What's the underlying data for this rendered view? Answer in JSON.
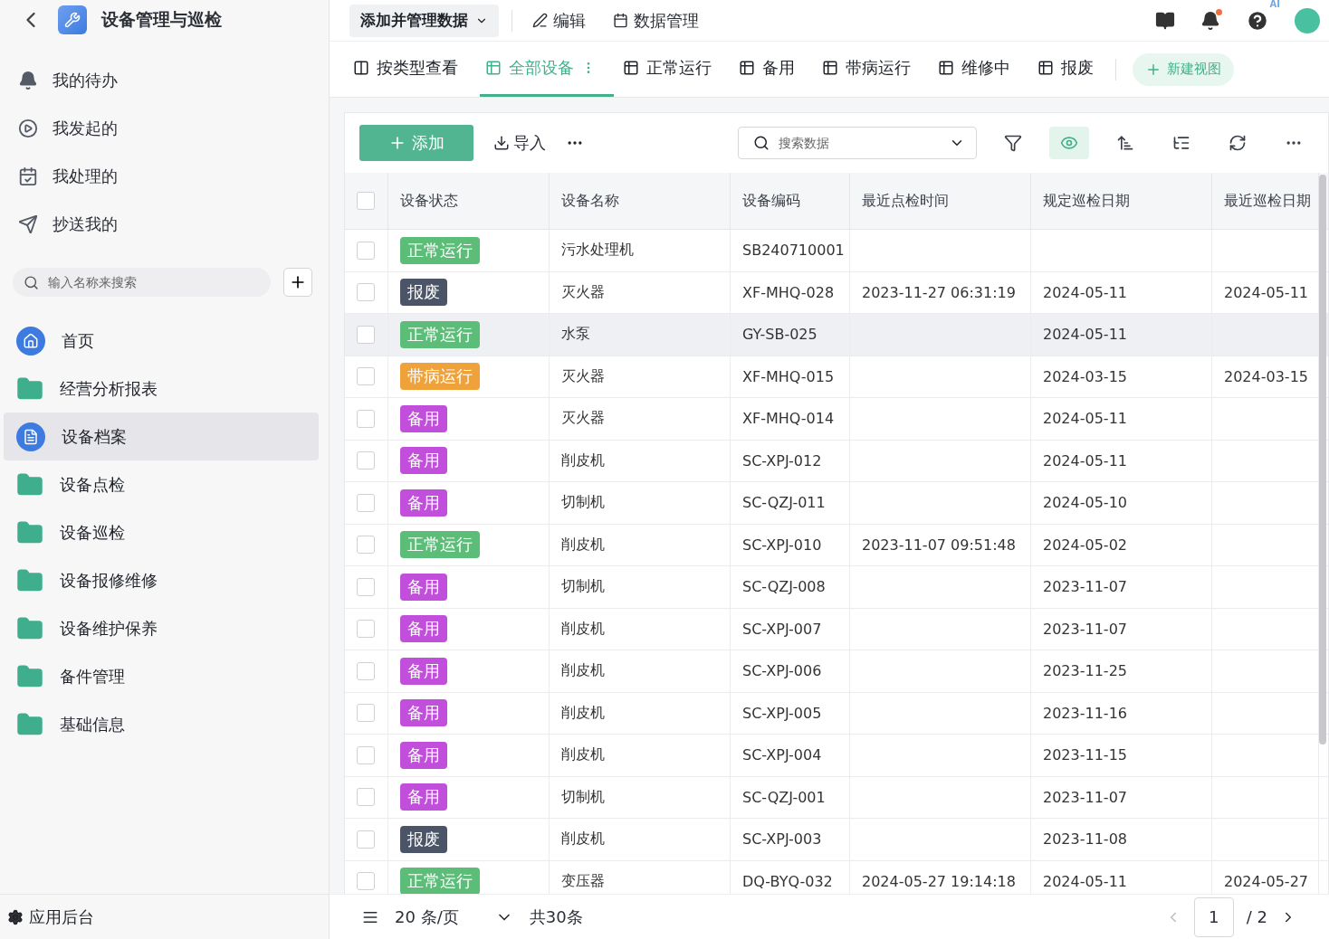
{
  "app": {
    "title": "设备管理与巡检"
  },
  "quick_links": [
    {
      "label": "我的待办"
    },
    {
      "label": "我发起的"
    },
    {
      "label": "我处理的"
    },
    {
      "label": "抄送我的"
    }
  ],
  "sidebar_search": {
    "placeholder": "输入名称来搜索"
  },
  "nav": [
    {
      "label": "首页",
      "kind": "home",
      "selected": false
    },
    {
      "label": "经营分析报表",
      "kind": "folder",
      "selected": false
    },
    {
      "label": "设备档案",
      "kind": "doc",
      "selected": true
    },
    {
      "label": "设备点检",
      "kind": "folder",
      "selected": false
    },
    {
      "label": "设备巡检",
      "kind": "folder",
      "selected": false
    },
    {
      "label": "设备报修维修",
      "kind": "folder",
      "selected": false
    },
    {
      "label": "设备维护保养",
      "kind": "folder",
      "selected": false
    },
    {
      "label": "备件管理",
      "kind": "folder",
      "selected": false
    },
    {
      "label": "基础信息",
      "kind": "folder",
      "selected": false
    }
  ],
  "sidebar_footer": "应用后台",
  "header": {
    "menu": "添加并管理数据",
    "actions": [
      "编辑",
      "数据管理"
    ],
    "ai_badge": "AI"
  },
  "view_tabs": [
    {
      "label": "按类型查看",
      "kind": "kanban",
      "selected": false
    },
    {
      "label": "全部设备",
      "kind": "table",
      "selected": true
    },
    {
      "label": "正常运行",
      "kind": "table",
      "selected": false
    },
    {
      "label": "备用",
      "kind": "table",
      "selected": false
    },
    {
      "label": "带病运行",
      "kind": "table",
      "selected": false
    },
    {
      "label": "维修中",
      "kind": "table",
      "selected": false
    },
    {
      "label": "报废",
      "kind": "table",
      "selected": false
    }
  ],
  "new_view": "新建视图",
  "toolbar": {
    "add": "添加",
    "import": "导入",
    "search": {
      "placeholder": "搜索数据"
    }
  },
  "table": {
    "select_all": {
      "checked": false
    },
    "columns": [
      "设备状态",
      "设备名称",
      "设备编码",
      "最近点检时间",
      "规定巡检日期",
      "最近巡检日期"
    ],
    "rows": [
      {
        "checked": false,
        "status": "正常运行",
        "color": "#5cbd78",
        "name": "污水处理机",
        "code": "SB240710001",
        "check_time": "",
        "due": "",
        "last": "",
        "hovered": false
      },
      {
        "checked": false,
        "status": "报废",
        "color": "#4b5567",
        "name": "灭火器",
        "code": "XF-MHQ-028",
        "check_time": "2023-11-27 06:31:19",
        "due": "2024-05-11",
        "last": "2024-05-11",
        "hovered": false
      },
      {
        "checked": false,
        "status": "正常运行",
        "color": "#5cbd78",
        "name": "水泵",
        "code": "GY-SB-025",
        "check_time": "",
        "due": "2024-05-11",
        "last": "",
        "hovered": true
      },
      {
        "checked": false,
        "status": "带病运行",
        "color": "#f0a23a",
        "name": "灭火器",
        "code": "XF-MHQ-015",
        "check_time": "",
        "due": "2024-03-15",
        "last": "2024-03-15",
        "hovered": false
      },
      {
        "checked": false,
        "status": "备用",
        "color": "#c14fdb",
        "name": "灭火器",
        "code": "XF-MHQ-014",
        "check_time": "",
        "due": "2024-05-11",
        "last": "",
        "hovered": false
      },
      {
        "checked": false,
        "status": "备用",
        "color": "#c14fdb",
        "name": "削皮机",
        "code": "SC-XPJ-012",
        "check_time": "",
        "due": "2024-05-11",
        "last": "",
        "hovered": false
      },
      {
        "checked": false,
        "status": "备用",
        "color": "#c14fdb",
        "name": "切制机",
        "code": "SC-QZJ-011",
        "check_time": "",
        "due": "2024-05-10",
        "last": "",
        "hovered": false
      },
      {
        "checked": false,
        "status": "正常运行",
        "color": "#5cbd78",
        "name": "削皮机",
        "code": "SC-XPJ-010",
        "check_time": "2023-11-07 09:51:48",
        "due": "2024-05-02",
        "last": "",
        "hovered": false
      },
      {
        "checked": false,
        "status": "备用",
        "color": "#c14fdb",
        "name": "切制机",
        "code": "SC-QZJ-008",
        "check_time": "",
        "due": "2023-11-07",
        "last": "",
        "hovered": false
      },
      {
        "checked": false,
        "status": "备用",
        "color": "#c14fdb",
        "name": "削皮机",
        "code": "SC-XPJ-007",
        "check_time": "",
        "due": "2023-11-07",
        "last": "",
        "hovered": false
      },
      {
        "checked": false,
        "status": "备用",
        "color": "#c14fdb",
        "name": "削皮机",
        "code": "SC-XPJ-006",
        "check_time": "",
        "due": "2023-11-25",
        "last": "",
        "hovered": false
      },
      {
        "checked": false,
        "status": "备用",
        "color": "#c14fdb",
        "name": "削皮机",
        "code": "SC-XPJ-005",
        "check_time": "",
        "due": "2023-11-16",
        "last": "",
        "hovered": false
      },
      {
        "checked": false,
        "status": "备用",
        "color": "#c14fdb",
        "name": "削皮机",
        "code": "SC-XPJ-004",
        "check_time": "",
        "due": "2023-11-15",
        "last": "",
        "hovered": false
      },
      {
        "checked": false,
        "status": "备用",
        "color": "#c14fdb",
        "name": "切制机",
        "code": "SC-QZJ-001",
        "check_time": "",
        "due": "2023-11-07",
        "last": "",
        "hovered": false
      },
      {
        "checked": false,
        "status": "报废",
        "color": "#4b5567",
        "name": "削皮机",
        "code": "SC-XPJ-003",
        "check_time": "",
        "due": "2023-11-08",
        "last": "",
        "hovered": false
      },
      {
        "checked": false,
        "status": "正常运行",
        "color": "#5cbd78",
        "name": "变压器",
        "code": "DQ-BYQ-032",
        "check_time": "2024-05-27 19:14:18",
        "due": "2024-05-11",
        "last": "2024-05-27",
        "hovered": false
      }
    ]
  },
  "pagination": {
    "page_size": "20 条/页",
    "total": "共30条",
    "page": "1",
    "pages": "/ 2"
  }
}
